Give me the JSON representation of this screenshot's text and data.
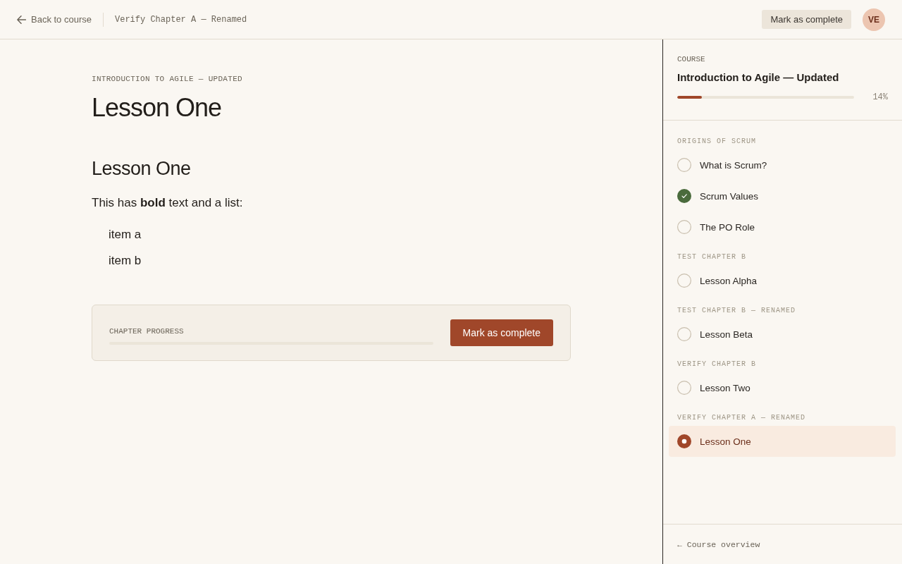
{
  "top_bar": {
    "back_link": "Back to course",
    "breadcrumb": "Verify Chapter A — Renamed",
    "complete_button": "Mark as complete",
    "avatar": "VE"
  },
  "lesson": {
    "eyebrow": "INTRODUCTION TO AGILE — UPDATED",
    "title": "Lesson One",
    "heading": "Lesson One",
    "paragraph": "This has **bold** text and a list:",
    "list_items": [
      "item a",
      "item b"
    ]
  },
  "chapter_progress": {
    "label": "CHAPTER PROGRESS",
    "button": "Mark as complete"
  },
  "sidebar": {
    "label": "COURSE",
    "course_title": "Introduction to Agile — Updated",
    "progress": {
      "level": 0.14,
      "reading": "14%"
    },
    "chapters": [
      {
        "title": "ORIGINS OF SCRUM",
        "lessons": [
          {
            "title": "What is Scrum?",
            "completed": false,
            "selected": false
          },
          {
            "title": "Scrum Values",
            "completed": true,
            "selected": false
          },
          {
            "title": "The PO Role",
            "completed": false,
            "selected": false
          }
        ]
      },
      {
        "title": "TEST CHAPTER B",
        "lessons": [
          {
            "title": "Lesson Alpha",
            "completed": false,
            "selected": false
          }
        ]
      },
      {
        "title": "TEST CHAPTER B — RENAMED",
        "lessons": [
          {
            "title": "Lesson Beta",
            "completed": false,
            "selected": false
          }
        ]
      },
      {
        "title": "VERIFY CHAPTER B",
        "lessons": [
          {
            "title": "Lesson Two",
            "completed": false,
            "selected": false
          }
        ]
      },
      {
        "title": "VERIFY CHAPTER A — RENAMED",
        "lessons": [
          {
            "title": "Lesson One",
            "completed": false,
            "selected": true
          }
        ]
      }
    ],
    "footer_link": "← Course overview"
  }
}
